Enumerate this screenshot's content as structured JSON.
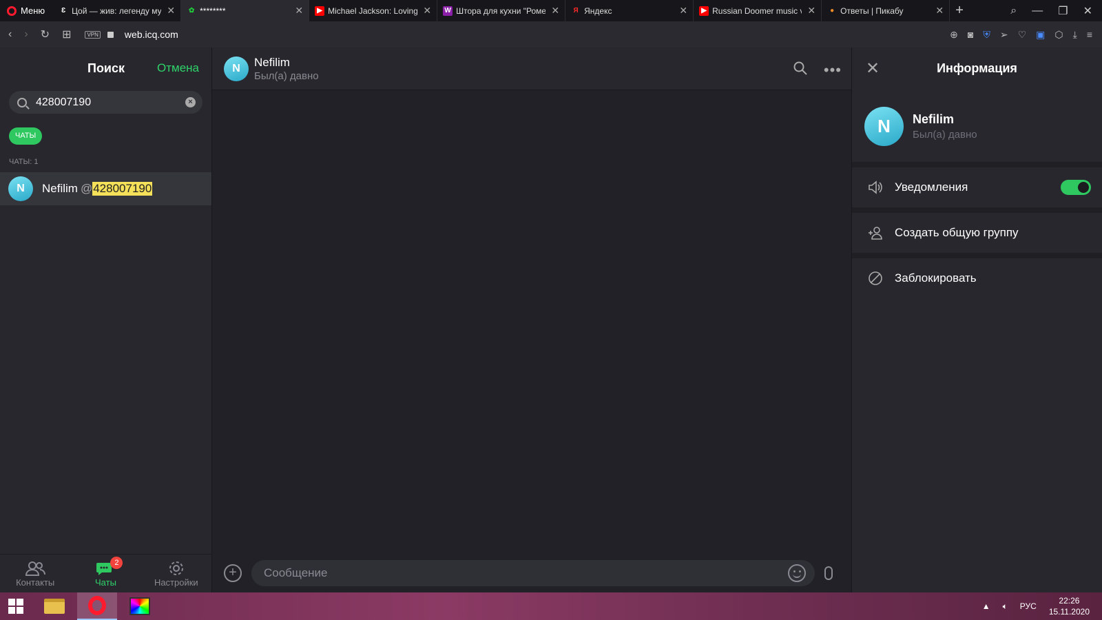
{
  "browser": {
    "menu_label": "Меню",
    "tabs": [
      {
        "title": "Цой — жив: легенду му",
        "fav": "Ɛ",
        "fav_color": "#ffffff",
        "fav_bg": "transparent"
      },
      {
        "title": "********",
        "fav": "✿",
        "fav_color": "#1fcc3a",
        "fav_bg": "transparent"
      },
      {
        "title": "Michael Jackson: Loving",
        "fav": "▶",
        "fav_color": "#ffffff",
        "fav_bg": "#ff0000"
      },
      {
        "title": "Штора для кухни \"Роме",
        "fav": "W",
        "fav_color": "#ffffff",
        "fav_bg": "#8b1fa8"
      },
      {
        "title": "Яндекс",
        "fav": "Я",
        "fav_color": "#ff2a2a",
        "fav_bg": "transparent"
      },
      {
        "title": "Russian Doomer music v",
        "fav": "▶",
        "fav_color": "#ffffff",
        "fav_bg": "#ff0000"
      },
      {
        "title": "Ответы | Пикабу",
        "fav": "●",
        "fav_color": "#f28c28",
        "fav_bg": "transparent"
      }
    ],
    "vpn_label": "VPN",
    "url": "web.icq.com"
  },
  "sidebar": {
    "title": "Поиск",
    "cancel": "Отмена",
    "search_value": "428007190",
    "filter_chip": "ЧАТЫ",
    "section_label": "ЧАТЫ: 1",
    "result": {
      "avatar_letter": "N",
      "name": "Nefilim",
      "at": "@",
      "handle": "428007190"
    },
    "nav": {
      "contacts": "Контакты",
      "chats": "Чаты",
      "chats_badge": "2",
      "settings": "Настройки"
    }
  },
  "chat": {
    "avatar_letter": "N",
    "name": "Nefilim",
    "status": "Был(а) давно",
    "composer_placeholder": "Сообщение"
  },
  "info": {
    "title": "Информация",
    "avatar_letter": "N",
    "name": "Nefilim",
    "status": "Был(а) давно",
    "notifications_label": "Уведомления",
    "notifications_on": true,
    "create_group_label": "Создать общую группу",
    "block_label": "Заблокировать"
  },
  "taskbar": {
    "lang": "РУС",
    "time": "22:26",
    "date": "15.11.2020"
  },
  "colors": {
    "accent": "#2fc860",
    "badge": "#f2443c",
    "highlight": "#f5e05a"
  }
}
